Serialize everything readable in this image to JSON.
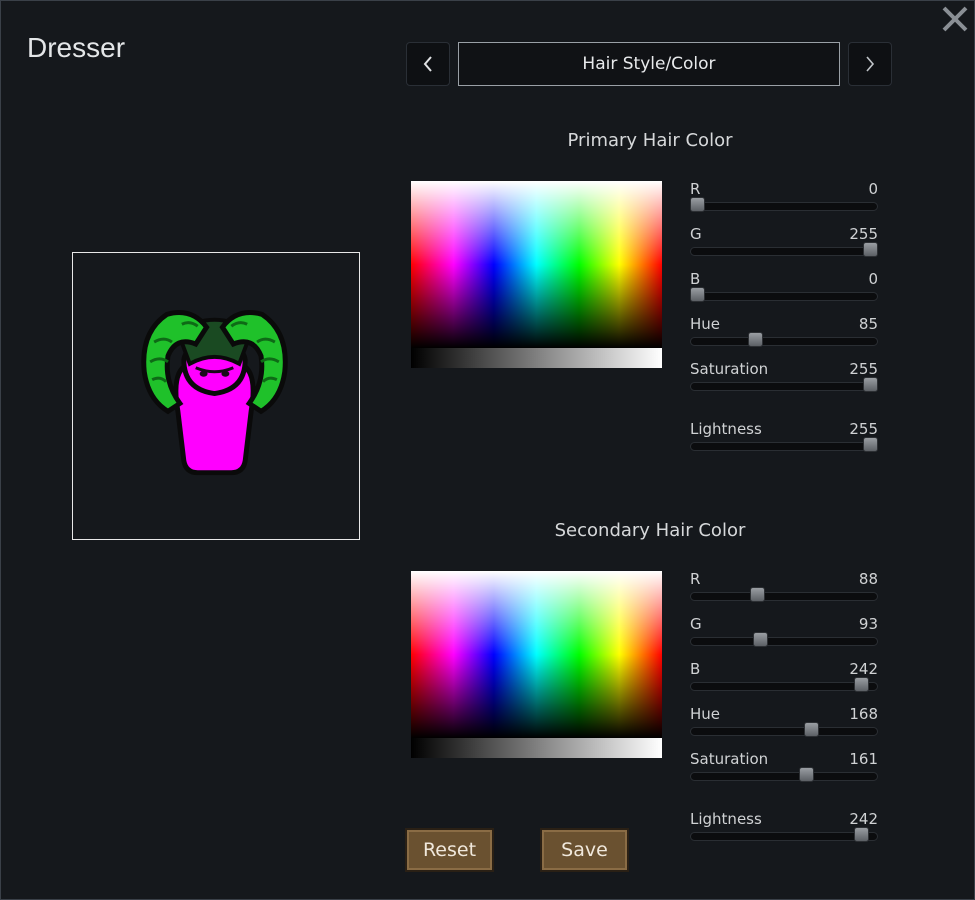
{
  "window": {
    "title": "Dresser"
  },
  "nav": {
    "category": "Hair Style/Color"
  },
  "primary": {
    "title": "Primary Hair Color",
    "sliders": [
      {
        "label": "R",
        "value": "0",
        "fraction": 0.0
      },
      {
        "label": "G",
        "value": "255",
        "fraction": 1.0
      },
      {
        "label": "B",
        "value": "0",
        "fraction": 0.0
      },
      {
        "label": "Hue",
        "value": "85",
        "fraction": 0.333
      },
      {
        "label": "Saturation",
        "value": "255",
        "fraction": 1.0
      },
      {
        "label": "Lightness",
        "value": "255",
        "fraction": 1.0
      }
    ]
  },
  "secondary": {
    "title": "Secondary Hair Color",
    "sliders": [
      {
        "label": "R",
        "value": "88",
        "fraction": 0.345
      },
      {
        "label": "G",
        "value": "93",
        "fraction": 0.365
      },
      {
        "label": "B",
        "value": "242",
        "fraction": 0.949
      },
      {
        "label": "Hue",
        "value": "168",
        "fraction": 0.659
      },
      {
        "label": "Saturation",
        "value": "161",
        "fraction": 0.631
      },
      {
        "label": "Lightness",
        "value": "242",
        "fraction": 0.949
      }
    ]
  },
  "buttons": {
    "reset": "Reset",
    "save": "Save"
  },
  "colors": {
    "primary_hair": "#00ff00",
    "secondary_hair": "#585df2",
    "body": "#ff00ff",
    "button": "#6a5130"
  }
}
